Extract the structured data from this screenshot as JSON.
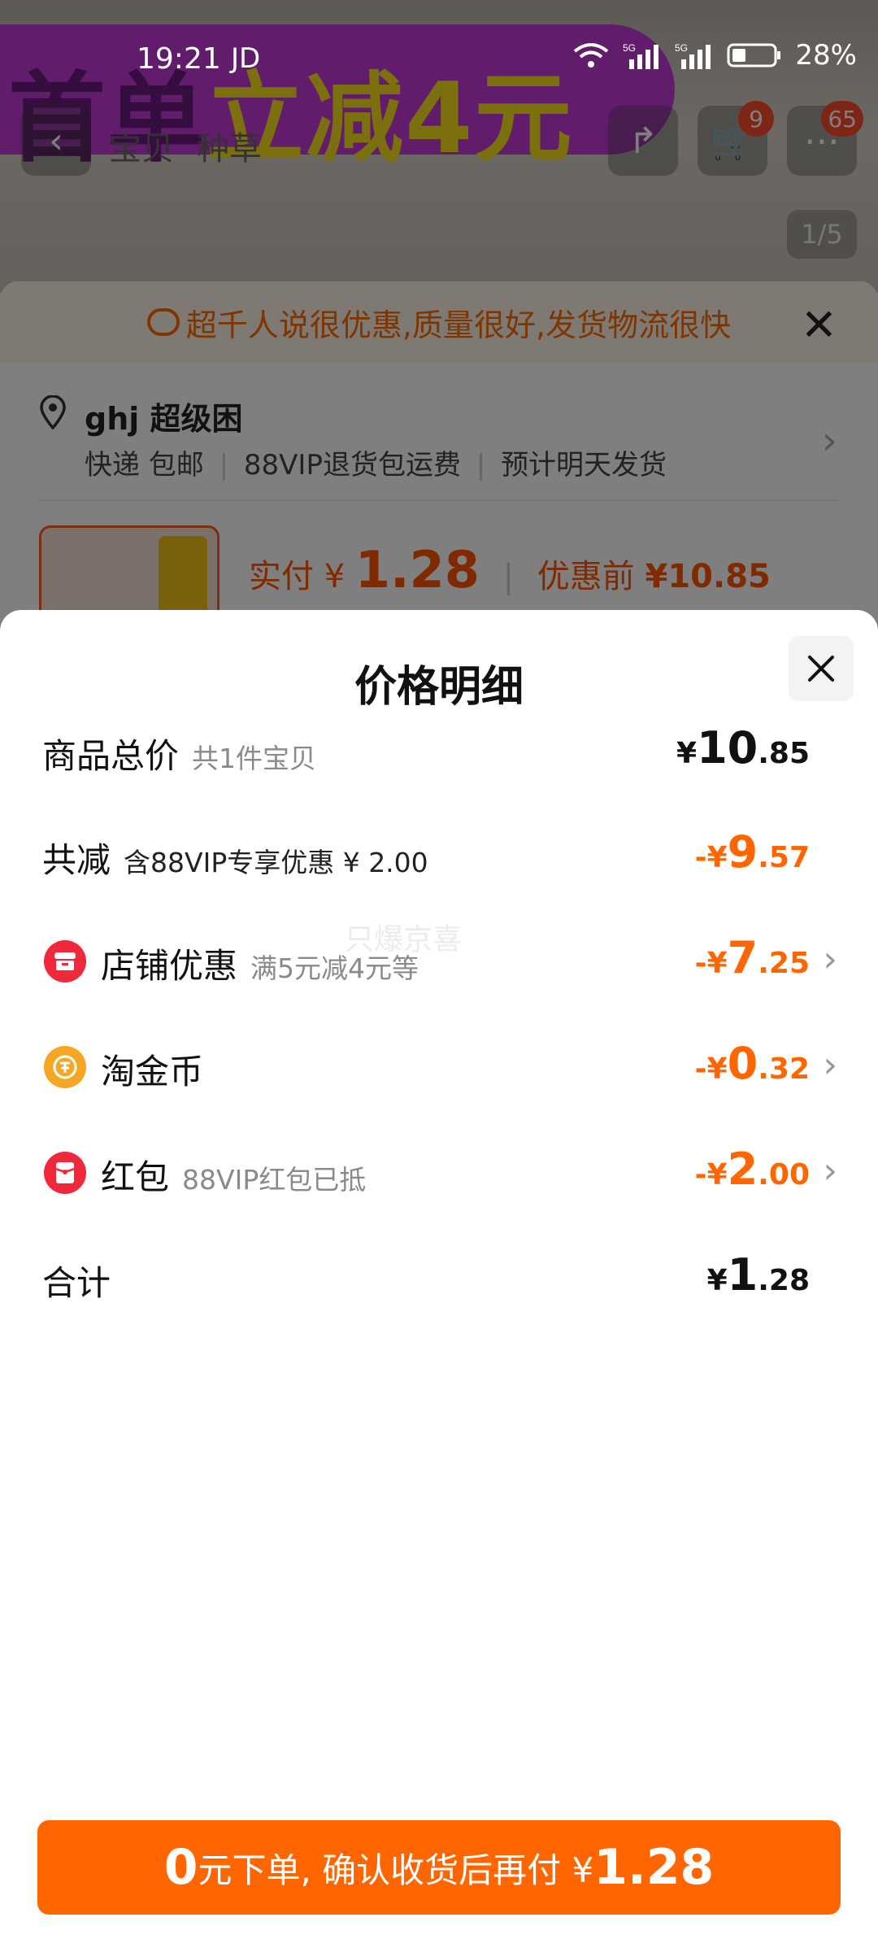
{
  "status_bar": {
    "time": "19:21",
    "carrier": "JD",
    "battery": "28%"
  },
  "background": {
    "promo": {
      "part1": "首单",
      "part2": "立减4元"
    },
    "nav_tabs": [
      "宝贝",
      "种草"
    ],
    "cart_badge": "9",
    "msg_badge": "65",
    "image_counter": "1/5",
    "review_banner": "超千人说很优惠,质量很好,发货物流很快",
    "address": {
      "name": "ghj 超级困",
      "delivery": "快递 包邮",
      "return_policy": "88VIP退货包运费",
      "ship_estimate": "预计明天发货"
    },
    "price": {
      "paid_label": "实付",
      "paid_symbol": "¥",
      "paid_value": "1.28",
      "before_label": "优惠前",
      "before_value": "¥10.85"
    }
  },
  "sheet": {
    "title": "价格明细",
    "watermark": "只爆京喜",
    "rows": [
      {
        "label": "商品总价",
        "note": "共1件宝贝",
        "sign": "",
        "symbol": "¥",
        "int": "10",
        "dec": ".85"
      },
      {
        "label": "共减",
        "note": "含88VIP专享优惠 ¥ 2.00",
        "sign": "-",
        "symbol": "¥",
        "int": "9",
        "dec": ".57"
      },
      {
        "label": "店铺优惠",
        "note": "满5元减4元等",
        "sign": "-",
        "symbol": "¥",
        "int": "7",
        "dec": ".25"
      },
      {
        "label": "淘金币",
        "note": "",
        "sign": "-",
        "symbol": "¥",
        "int": "0",
        "dec": ".32"
      },
      {
        "label": "红包",
        "note": "88VIP红包已抵",
        "sign": "-",
        "symbol": "¥",
        "int": "2",
        "dec": ".00"
      },
      {
        "label": "合计",
        "note": "",
        "sign": "",
        "symbol": "¥",
        "int": "1",
        "dec": ".28"
      }
    ],
    "cta": {
      "num": "0",
      "text": "元下单, 确认收货后再付 ¥",
      "amount": "1.28"
    }
  },
  "colors": {
    "accent": "#ff6600",
    "shop_icon": "#f0283c",
    "coin_icon": "#f5a623",
    "redpacket_icon": "#f0283c"
  }
}
